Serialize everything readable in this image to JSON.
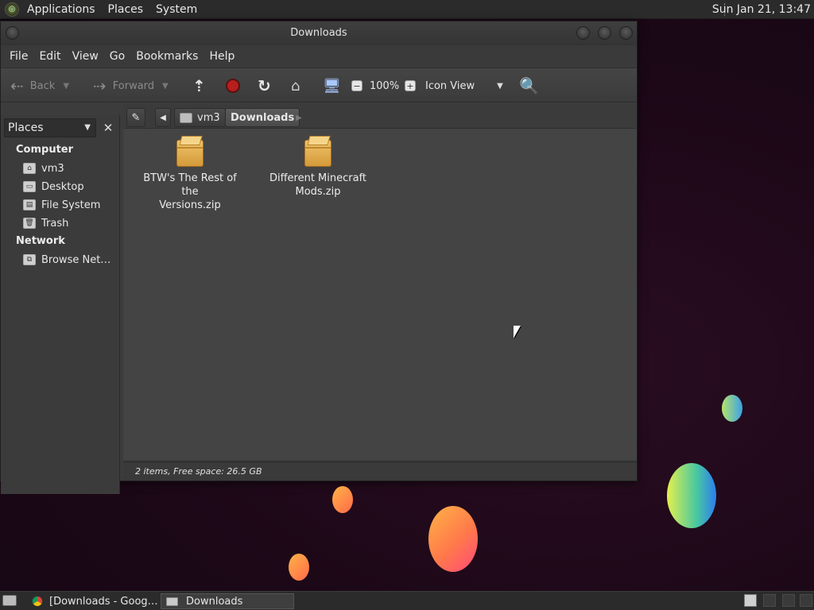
{
  "top_panel": {
    "menus": [
      "Applications",
      "Places",
      "System"
    ],
    "clock": "Sun Jan 21, 13:47"
  },
  "window": {
    "title": "Downloads",
    "menus": [
      "File",
      "Edit",
      "View",
      "Go",
      "Bookmarks",
      "Help"
    ],
    "toolbar": {
      "back": "Back",
      "forward": "Forward",
      "zoom": "100%",
      "view_mode": "Icon View"
    },
    "sidebar": {
      "selector": "Places",
      "sections": [
        {
          "title": "Computer",
          "items": [
            "vm3",
            "Desktop",
            "File System",
            "Trash"
          ]
        },
        {
          "title": "Network",
          "items": [
            "Browse Net…"
          ]
        }
      ]
    },
    "location": {
      "crumbs": [
        "vm3",
        "Downloads"
      ]
    },
    "files": [
      {
        "name": "BTW's The Rest of the Versions.zip",
        "line1": "BTW's The Rest of the",
        "line2": "Versions.zip"
      },
      {
        "name": "Different Minecraft Mods.zip",
        "line1": "Different Minecraft",
        "line2": "Mods.zip"
      }
    ],
    "status": "2 items, Free space: 26.5 GB"
  },
  "taskbar": {
    "tasks": [
      "[Downloads - Goog…",
      "Downloads"
    ]
  }
}
